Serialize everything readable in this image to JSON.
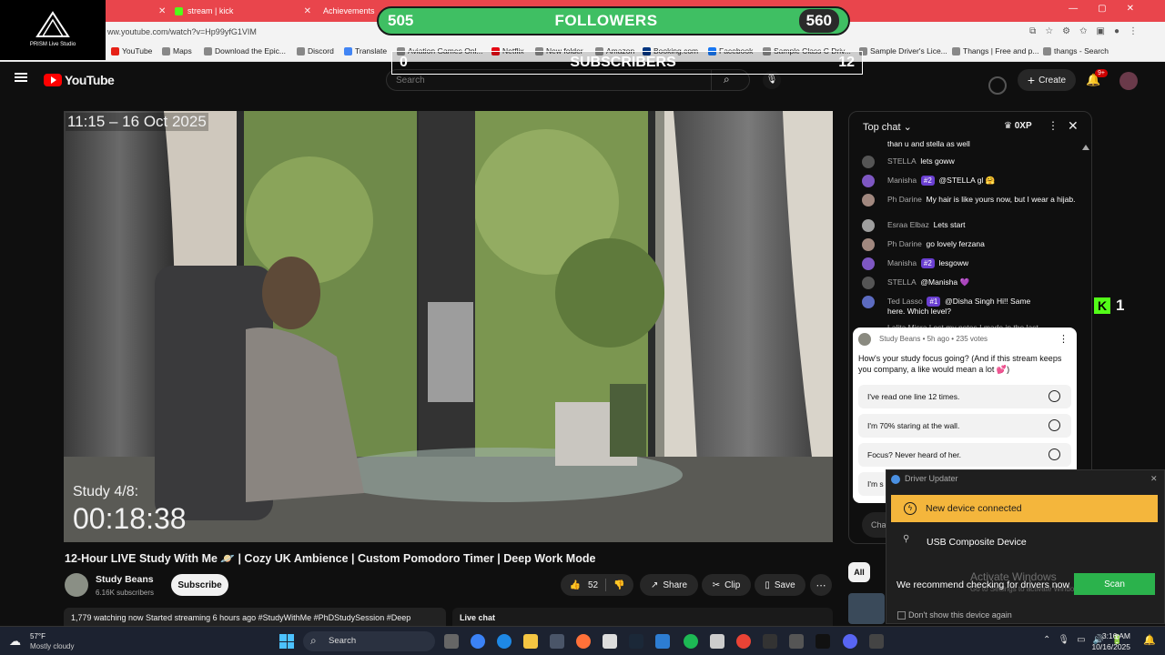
{
  "browser": {
    "tabs": [
      {
        "label": "stream | kick"
      },
      {
        "label": "Achievements"
      }
    ],
    "url": "ww.youtube.com/watch?v=Hp99yfG1VIM",
    "bookmarks": [
      "YouTube",
      "Maps",
      "Download the Epic...",
      "Discord",
      "Translate",
      "Aviation Games Onl...",
      "Netflix",
      "New folder",
      "Amazon",
      "Booking.com",
      "Facebook",
      "Sample Class C Driv...",
      "Sample Driver's Lice...",
      "Thangs | Free and p...",
      "thangs - Search"
    ]
  },
  "prism": {
    "label": "PRISM Live Studio"
  },
  "overlay": {
    "followers_current": "505",
    "followers_label": "FOLLOWERS",
    "followers_goal": "560",
    "followers_progress": 0.4,
    "subscribers_current": "0",
    "subscribers_label": "SUBSCRIBERS",
    "subscribers_goal": "12",
    "kick_count": "1"
  },
  "youtube": {
    "logo_text": "YouTube",
    "search_placeholder": "Search",
    "create_label": "Create",
    "notif_badge": "9+"
  },
  "video": {
    "timestamp": "11:15 – 16 Oct 2025",
    "study_label": "Study 4/8:",
    "timer": "00:18:38"
  },
  "info": {
    "title": "12-Hour LIVE Study With Me 🪐 | Cozy UK Ambience | Custom Pomodoro Timer | Deep Work Mode",
    "channel": "Study Beans",
    "subscribers": "6.16K subscribers",
    "subscribe_label": "Subscribe",
    "likes": "52",
    "share_label": "Share",
    "clip_label": "Clip",
    "save_label": "Save",
    "stats": "1,779 watching now  Started streaming 6 hours ago  #StudyWithMe #PhDStudySession #Deep",
    "live_chat_label": "Live chat",
    "all_label": "All"
  },
  "chat": {
    "header": "Top chat",
    "xp": "0XP",
    "cut_top": "than u and stella as well",
    "messages": [
      {
        "name": "STELLA",
        "badge": "",
        "text": "lets goww",
        "color": "#555"
      },
      {
        "name": "Manisha",
        "badge": "#2",
        "text": "@STELLA gl 🤗",
        "color": "#7e57c2"
      },
      {
        "name": "Ph Darine",
        "badge": "",
        "text": "My hair is like yours now, but I wear a hijab.",
        "color": "#a1887f"
      },
      {
        "name": "Esraa Elbaz",
        "badge": "",
        "text": "Lets start",
        "color": "#9e9e9e"
      },
      {
        "name": "Ph Darine",
        "badge": "",
        "text": "go lovely ferzana",
        "color": "#a1887f"
      },
      {
        "name": "Manisha",
        "badge": "#2",
        "text": "lesgoww",
        "color": "#7e57c2"
      },
      {
        "name": "STELLA",
        "badge": "",
        "text": "@Manisha 💜",
        "color": "#555"
      },
      {
        "name": "Ted Lasso",
        "badge": "#1",
        "text": "@Disha Singh Hi!! Same here. Which level?",
        "color": "#5c6bc0"
      }
    ],
    "cut_bottom": "Lalita Misra  Lost my notes I made in the last",
    "input_placeholder": "Cha"
  },
  "poll": {
    "meta": "Study Beans • 5h ago • 235 votes",
    "question": "How's your study focus going? (And if this stream keeps you company, a like would mean a lot 💕)",
    "options": [
      "I've read one line 12 times.",
      "I'm 70% staring at the wall.",
      "Focus? Never heard of her.",
      "I'm s"
    ]
  },
  "driver": {
    "title": "Driver Updater",
    "alert": "New device connected",
    "device": "USB Composite Device",
    "recommend": "We recommend checking for drivers now",
    "scan_label": "Scan",
    "checkbox_label": "Don't show this device again",
    "watermark": "Activate Windows",
    "watermark_sub": "Go to Settings to activate Windows."
  },
  "taskbar": {
    "temp": "57°F",
    "weather": "Mostly cloudy",
    "search_label": "Search",
    "time": "3:16 AM",
    "date": "10/16/2025"
  }
}
